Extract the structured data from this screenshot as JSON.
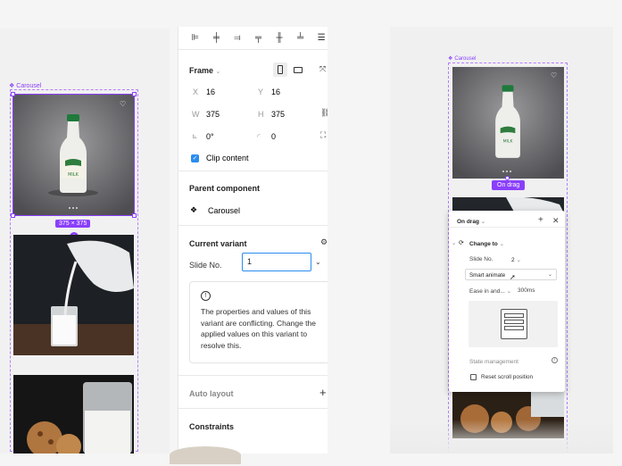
{
  "left": {
    "frame_label": "Carousel",
    "size_badge": "375 × 375"
  },
  "toolbar": {
    "align_icons": [
      "align-left-icon",
      "align-center-h-icon",
      "align-right-icon",
      "align-top-icon",
      "align-center-v-icon",
      "align-bottom-icon",
      "distribute-icon"
    ]
  },
  "frame": {
    "title": "Frame",
    "x_label": "X",
    "x_value": "16",
    "y_label": "Y",
    "y_value": "16",
    "w_label": "W",
    "w_value": "375",
    "h_label": "H",
    "h_value": "375",
    "rotation_value": "0°",
    "radius_value": "0",
    "clip_content": "Clip content"
  },
  "parent_component": {
    "title": "Parent component",
    "name": "Carousel"
  },
  "current_variant": {
    "title": "Current variant",
    "slide_label": "Slide No.",
    "slide_value": "1",
    "warning": "The properties and values of this variant are conflicting. Change the applied values on this variant to resolve this."
  },
  "auto_layout": {
    "title": "Auto layout"
  },
  "constraints": {
    "title": "Constraints"
  },
  "right": {
    "frame_label": "Carousel",
    "on_drag_badge": "On drag",
    "popover": {
      "title": "On drag",
      "action": "Change to",
      "slide_label": "Slide No.",
      "slide_value": "2",
      "animation": "Smart animate",
      "easing": "Ease in and...",
      "duration": "300ms",
      "state_management": "State management",
      "reset_scroll": "Reset scroll position"
    }
  },
  "colors": {
    "accent": "#8a3ffc",
    "blue": "#2a8cf0"
  }
}
